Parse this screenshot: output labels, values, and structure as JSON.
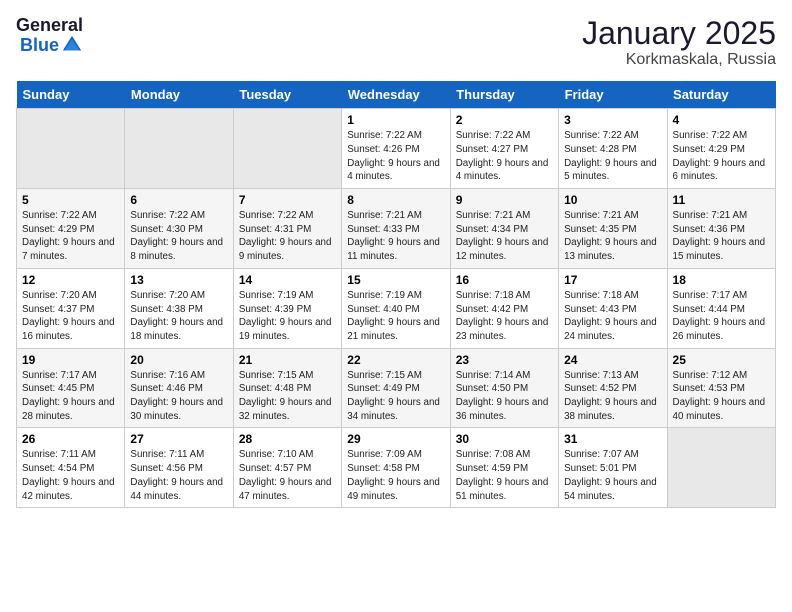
{
  "header": {
    "logo_general": "General",
    "logo_blue": "Blue",
    "title": "January 2025",
    "subtitle": "Korkmaskala, Russia"
  },
  "weekdays": [
    "Sunday",
    "Monday",
    "Tuesday",
    "Wednesday",
    "Thursday",
    "Friday",
    "Saturday"
  ],
  "weeks": [
    [
      {
        "day": "",
        "info": ""
      },
      {
        "day": "",
        "info": ""
      },
      {
        "day": "",
        "info": ""
      },
      {
        "day": "1",
        "info": "Sunrise: 7:22 AM\nSunset: 4:26 PM\nDaylight: 9 hours and 4 minutes."
      },
      {
        "day": "2",
        "info": "Sunrise: 7:22 AM\nSunset: 4:27 PM\nDaylight: 9 hours and 4 minutes."
      },
      {
        "day": "3",
        "info": "Sunrise: 7:22 AM\nSunset: 4:28 PM\nDaylight: 9 hours and 5 minutes."
      },
      {
        "day": "4",
        "info": "Sunrise: 7:22 AM\nSunset: 4:29 PM\nDaylight: 9 hours and 6 minutes."
      }
    ],
    [
      {
        "day": "5",
        "info": "Sunrise: 7:22 AM\nSunset: 4:29 PM\nDaylight: 9 hours and 7 minutes."
      },
      {
        "day": "6",
        "info": "Sunrise: 7:22 AM\nSunset: 4:30 PM\nDaylight: 9 hours and 8 minutes."
      },
      {
        "day": "7",
        "info": "Sunrise: 7:22 AM\nSunset: 4:31 PM\nDaylight: 9 hours and 9 minutes."
      },
      {
        "day": "8",
        "info": "Sunrise: 7:21 AM\nSunset: 4:33 PM\nDaylight: 9 hours and 11 minutes."
      },
      {
        "day": "9",
        "info": "Sunrise: 7:21 AM\nSunset: 4:34 PM\nDaylight: 9 hours and 12 minutes."
      },
      {
        "day": "10",
        "info": "Sunrise: 7:21 AM\nSunset: 4:35 PM\nDaylight: 9 hours and 13 minutes."
      },
      {
        "day": "11",
        "info": "Sunrise: 7:21 AM\nSunset: 4:36 PM\nDaylight: 9 hours and 15 minutes."
      }
    ],
    [
      {
        "day": "12",
        "info": "Sunrise: 7:20 AM\nSunset: 4:37 PM\nDaylight: 9 hours and 16 minutes."
      },
      {
        "day": "13",
        "info": "Sunrise: 7:20 AM\nSunset: 4:38 PM\nDaylight: 9 hours and 18 minutes."
      },
      {
        "day": "14",
        "info": "Sunrise: 7:19 AM\nSunset: 4:39 PM\nDaylight: 9 hours and 19 minutes."
      },
      {
        "day": "15",
        "info": "Sunrise: 7:19 AM\nSunset: 4:40 PM\nDaylight: 9 hours and 21 minutes."
      },
      {
        "day": "16",
        "info": "Sunrise: 7:18 AM\nSunset: 4:42 PM\nDaylight: 9 hours and 23 minutes."
      },
      {
        "day": "17",
        "info": "Sunrise: 7:18 AM\nSunset: 4:43 PM\nDaylight: 9 hours and 24 minutes."
      },
      {
        "day": "18",
        "info": "Sunrise: 7:17 AM\nSunset: 4:44 PM\nDaylight: 9 hours and 26 minutes."
      }
    ],
    [
      {
        "day": "19",
        "info": "Sunrise: 7:17 AM\nSunset: 4:45 PM\nDaylight: 9 hours and 28 minutes."
      },
      {
        "day": "20",
        "info": "Sunrise: 7:16 AM\nSunset: 4:46 PM\nDaylight: 9 hours and 30 minutes."
      },
      {
        "day": "21",
        "info": "Sunrise: 7:15 AM\nSunset: 4:48 PM\nDaylight: 9 hours and 32 minutes."
      },
      {
        "day": "22",
        "info": "Sunrise: 7:15 AM\nSunset: 4:49 PM\nDaylight: 9 hours and 34 minutes."
      },
      {
        "day": "23",
        "info": "Sunrise: 7:14 AM\nSunset: 4:50 PM\nDaylight: 9 hours and 36 minutes."
      },
      {
        "day": "24",
        "info": "Sunrise: 7:13 AM\nSunset: 4:52 PM\nDaylight: 9 hours and 38 minutes."
      },
      {
        "day": "25",
        "info": "Sunrise: 7:12 AM\nSunset: 4:53 PM\nDaylight: 9 hours and 40 minutes."
      }
    ],
    [
      {
        "day": "26",
        "info": "Sunrise: 7:11 AM\nSunset: 4:54 PM\nDaylight: 9 hours and 42 minutes."
      },
      {
        "day": "27",
        "info": "Sunrise: 7:11 AM\nSunset: 4:56 PM\nDaylight: 9 hours and 44 minutes."
      },
      {
        "day": "28",
        "info": "Sunrise: 7:10 AM\nSunset: 4:57 PM\nDaylight: 9 hours and 47 minutes."
      },
      {
        "day": "29",
        "info": "Sunrise: 7:09 AM\nSunset: 4:58 PM\nDaylight: 9 hours and 49 minutes."
      },
      {
        "day": "30",
        "info": "Sunrise: 7:08 AM\nSunset: 4:59 PM\nDaylight: 9 hours and 51 minutes."
      },
      {
        "day": "31",
        "info": "Sunrise: 7:07 AM\nSunset: 5:01 PM\nDaylight: 9 hours and 54 minutes."
      },
      {
        "day": "",
        "info": ""
      }
    ]
  ]
}
